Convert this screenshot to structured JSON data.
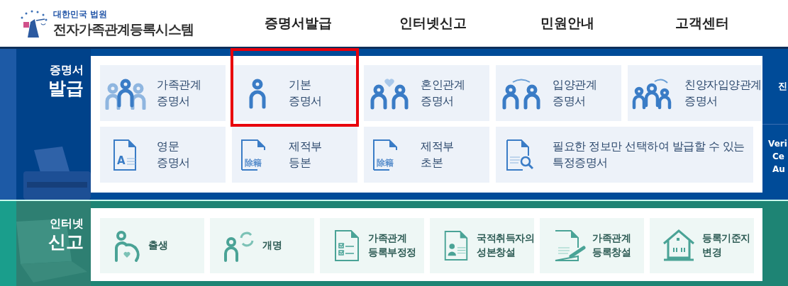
{
  "header": {
    "logo_top": "대한민국 법원",
    "logo_title": "전자가족관계등록시스템",
    "nav": [
      {
        "label": "증명서발급"
      },
      {
        "label": "인터넷신고"
      },
      {
        "label": "민원안내"
      },
      {
        "label": "고객센터"
      }
    ]
  },
  "issue": {
    "title_small": "증명서",
    "title_big": "발급",
    "tiles": [
      {
        "kind": "family",
        "lines": [
          "가족관계",
          "증명서"
        ],
        "highlighted": false
      },
      {
        "kind": "person",
        "lines": [
          "기본",
          "증명서"
        ],
        "highlighted": true
      },
      {
        "kind": "marriage",
        "lines": [
          "혼인관계",
          "증명서"
        ],
        "highlighted": false
      },
      {
        "kind": "adoption",
        "lines": [
          "입양관계",
          "증명서"
        ],
        "highlighted": false
      },
      {
        "kind": "step-adoption",
        "lines": [
          "친양자입양관계",
          "증명서"
        ],
        "highlighted": false
      },
      {
        "kind": "english-doc",
        "icon_text": "A",
        "lines": [
          "영문",
          "증명서"
        ],
        "highlighted": false
      },
      {
        "kind": "hanja-doc",
        "icon_text": "除籍",
        "lines": [
          "제적부",
          "등본"
        ],
        "highlighted": false
      },
      {
        "kind": "hanja-doc",
        "icon_text": "除籍",
        "lines": [
          "제적부",
          "초본"
        ],
        "highlighted": false
      },
      {
        "kind": "search-doc",
        "lines": [
          "필요한 정보만 선택하여 발급할 수 있는",
          "특정증명서"
        ],
        "highlighted": false
      }
    ],
    "side_top": [
      "진"
    ],
    "side_bottom": [
      "Veri",
      "Ce",
      "Au"
    ]
  },
  "report": {
    "title_small": "인터넷",
    "title_big": "신고",
    "tiles": [
      {
        "kind": "birth",
        "lines": [
          "출생"
        ]
      },
      {
        "kind": "rename",
        "lines": [
          "개명"
        ]
      },
      {
        "kind": "checklist-doc",
        "lines": [
          "가족관계",
          "등록부정정"
        ]
      },
      {
        "kind": "id-doc",
        "lines": [
          "국적취득자의",
          "성본창설"
        ]
      },
      {
        "kind": "pen-doc",
        "lines": [
          "가족관계",
          "등록창설"
        ]
      },
      {
        "kind": "house",
        "lines": [
          "등록기준지",
          "변경"
        ]
      }
    ]
  }
}
